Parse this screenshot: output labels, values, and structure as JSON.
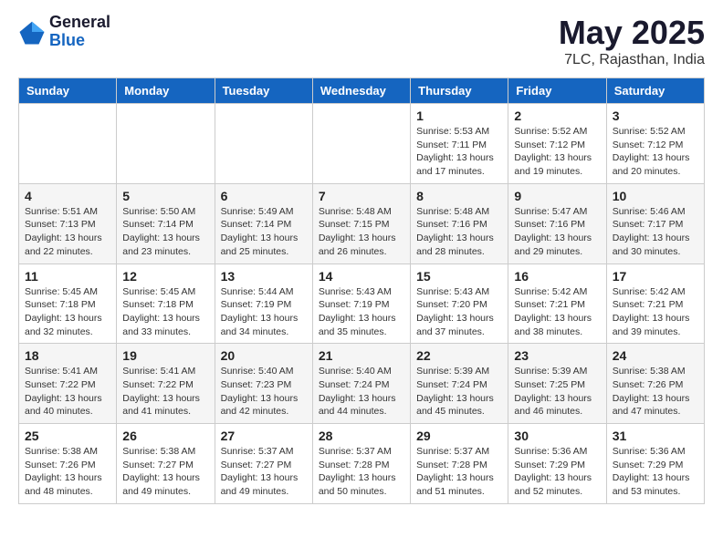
{
  "logo": {
    "general": "General",
    "blue": "Blue"
  },
  "header": {
    "month": "May 2025",
    "location": "7LC, Rajasthan, India"
  },
  "days_of_week": [
    "Sunday",
    "Monday",
    "Tuesday",
    "Wednesday",
    "Thursday",
    "Friday",
    "Saturday"
  ],
  "weeks": [
    [
      {
        "day": "",
        "info": ""
      },
      {
        "day": "",
        "info": ""
      },
      {
        "day": "",
        "info": ""
      },
      {
        "day": "",
        "info": ""
      },
      {
        "day": "1",
        "info": "Sunrise: 5:53 AM\nSunset: 7:11 PM\nDaylight: 13 hours and 17 minutes."
      },
      {
        "day": "2",
        "info": "Sunrise: 5:52 AM\nSunset: 7:12 PM\nDaylight: 13 hours and 19 minutes."
      },
      {
        "day": "3",
        "info": "Sunrise: 5:52 AM\nSunset: 7:12 PM\nDaylight: 13 hours and 20 minutes."
      }
    ],
    [
      {
        "day": "4",
        "info": "Sunrise: 5:51 AM\nSunset: 7:13 PM\nDaylight: 13 hours and 22 minutes."
      },
      {
        "day": "5",
        "info": "Sunrise: 5:50 AM\nSunset: 7:14 PM\nDaylight: 13 hours and 23 minutes."
      },
      {
        "day": "6",
        "info": "Sunrise: 5:49 AM\nSunset: 7:14 PM\nDaylight: 13 hours and 25 minutes."
      },
      {
        "day": "7",
        "info": "Sunrise: 5:48 AM\nSunset: 7:15 PM\nDaylight: 13 hours and 26 minutes."
      },
      {
        "day": "8",
        "info": "Sunrise: 5:48 AM\nSunset: 7:16 PM\nDaylight: 13 hours and 28 minutes."
      },
      {
        "day": "9",
        "info": "Sunrise: 5:47 AM\nSunset: 7:16 PM\nDaylight: 13 hours and 29 minutes."
      },
      {
        "day": "10",
        "info": "Sunrise: 5:46 AM\nSunset: 7:17 PM\nDaylight: 13 hours and 30 minutes."
      }
    ],
    [
      {
        "day": "11",
        "info": "Sunrise: 5:45 AM\nSunset: 7:18 PM\nDaylight: 13 hours and 32 minutes."
      },
      {
        "day": "12",
        "info": "Sunrise: 5:45 AM\nSunset: 7:18 PM\nDaylight: 13 hours and 33 minutes."
      },
      {
        "day": "13",
        "info": "Sunrise: 5:44 AM\nSunset: 7:19 PM\nDaylight: 13 hours and 34 minutes."
      },
      {
        "day": "14",
        "info": "Sunrise: 5:43 AM\nSunset: 7:19 PM\nDaylight: 13 hours and 35 minutes."
      },
      {
        "day": "15",
        "info": "Sunrise: 5:43 AM\nSunset: 7:20 PM\nDaylight: 13 hours and 37 minutes."
      },
      {
        "day": "16",
        "info": "Sunrise: 5:42 AM\nSunset: 7:21 PM\nDaylight: 13 hours and 38 minutes."
      },
      {
        "day": "17",
        "info": "Sunrise: 5:42 AM\nSunset: 7:21 PM\nDaylight: 13 hours and 39 minutes."
      }
    ],
    [
      {
        "day": "18",
        "info": "Sunrise: 5:41 AM\nSunset: 7:22 PM\nDaylight: 13 hours and 40 minutes."
      },
      {
        "day": "19",
        "info": "Sunrise: 5:41 AM\nSunset: 7:22 PM\nDaylight: 13 hours and 41 minutes."
      },
      {
        "day": "20",
        "info": "Sunrise: 5:40 AM\nSunset: 7:23 PM\nDaylight: 13 hours and 42 minutes."
      },
      {
        "day": "21",
        "info": "Sunrise: 5:40 AM\nSunset: 7:24 PM\nDaylight: 13 hours and 44 minutes."
      },
      {
        "day": "22",
        "info": "Sunrise: 5:39 AM\nSunset: 7:24 PM\nDaylight: 13 hours and 45 minutes."
      },
      {
        "day": "23",
        "info": "Sunrise: 5:39 AM\nSunset: 7:25 PM\nDaylight: 13 hours and 46 minutes."
      },
      {
        "day": "24",
        "info": "Sunrise: 5:38 AM\nSunset: 7:26 PM\nDaylight: 13 hours and 47 minutes."
      }
    ],
    [
      {
        "day": "25",
        "info": "Sunrise: 5:38 AM\nSunset: 7:26 PM\nDaylight: 13 hours and 48 minutes."
      },
      {
        "day": "26",
        "info": "Sunrise: 5:38 AM\nSunset: 7:27 PM\nDaylight: 13 hours and 49 minutes."
      },
      {
        "day": "27",
        "info": "Sunrise: 5:37 AM\nSunset: 7:27 PM\nDaylight: 13 hours and 49 minutes."
      },
      {
        "day": "28",
        "info": "Sunrise: 5:37 AM\nSunset: 7:28 PM\nDaylight: 13 hours and 50 minutes."
      },
      {
        "day": "29",
        "info": "Sunrise: 5:37 AM\nSunset: 7:28 PM\nDaylight: 13 hours and 51 minutes."
      },
      {
        "day": "30",
        "info": "Sunrise: 5:36 AM\nSunset: 7:29 PM\nDaylight: 13 hours and 52 minutes."
      },
      {
        "day": "31",
        "info": "Sunrise: 5:36 AM\nSunset: 7:29 PM\nDaylight: 13 hours and 53 minutes."
      }
    ]
  ]
}
